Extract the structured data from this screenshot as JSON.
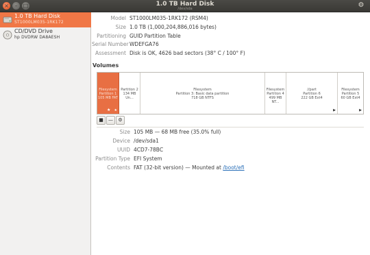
{
  "window": {
    "title": "1.0 TB Hard Disk",
    "subtitle": "/dev/sda",
    "buttons": {
      "close": "×",
      "minimize": "–",
      "maximize": "□"
    },
    "menu_icon": "gear-icon"
  },
  "sidebar": {
    "devices": [
      {
        "name": "1.0 TB Hard Disk",
        "sub": "ST1000LM035-1RK172",
        "icon": "hard-disk-icon",
        "selected": true
      },
      {
        "name": "CD/DVD Drive",
        "sub": "hp    DVDRW  DA8AESH",
        "icon": "optical-drive-icon",
        "selected": false
      }
    ]
  },
  "drive": {
    "model_label": "Model",
    "model": "ST1000LM035-1RK172 (RSM4)",
    "size_label": "Size",
    "size": "1.0 TB (1,000,204,886,016 bytes)",
    "partitioning_label": "Partitioning",
    "partitioning": "GUID Partition Table",
    "serial_label": "Serial Number",
    "serial": "WDEFGA76",
    "assessment_label": "Assessment",
    "assessment": "Disk is OK, 4626 bad sectors (38° C / 100° F)"
  },
  "volumes": {
    "heading": "Volumes",
    "segments": [
      {
        "l1": "Filesystem",
        "l2": "Partition 1",
        "l3": "105 MB FAT",
        "selected": true,
        "star": true
      },
      {
        "l1": "Partition 2",
        "l2": "134 MB Un...",
        "l3": ""
      },
      {
        "l1": "Filesystem",
        "l2": "Partition 3: Basic data partition",
        "l3": "718 GB NTFS"
      },
      {
        "l1": "Filesystem",
        "l2": "Partition 4",
        "l3": "499 MB NT..."
      },
      {
        "l1": "//part",
        "l2": "Partition 6",
        "l3": "222 GB Ext4"
      },
      {
        "l1": "Filesystem",
        "l2": "Partition 5",
        "l3": "60 GB Ext4"
      }
    ],
    "toolbar": {
      "stop": "■",
      "remove": "—",
      "options": "⚙"
    }
  },
  "selected_volume": {
    "size_label": "Size",
    "size": "105 MB — 68 MB free (35.0% full)",
    "device_label": "Device",
    "device": "/dev/sda1",
    "uuid_label": "UUID",
    "uuid": "4CD7-78BC",
    "ptype_label": "Partition Type",
    "ptype": "EFI System",
    "contents_label": "Contents",
    "contents": "FAT (32-bit version) — Mounted at ",
    "mount_link": "/boot/efi"
  }
}
